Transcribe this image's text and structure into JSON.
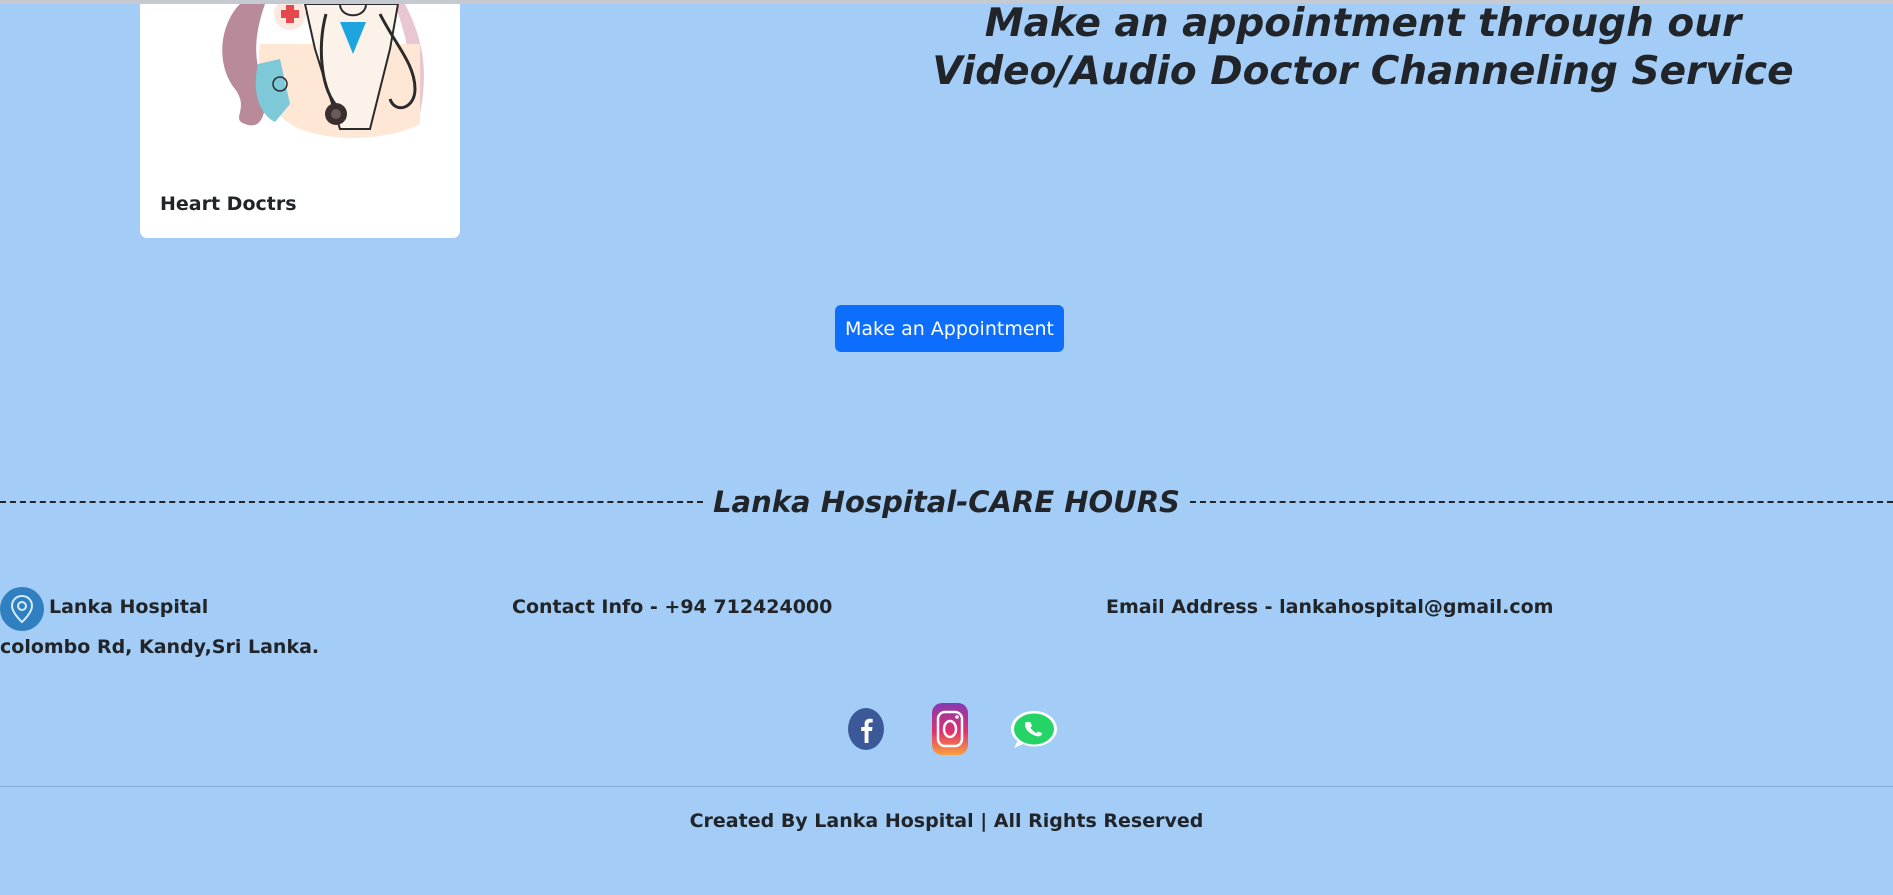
{
  "card": {
    "title": "Heart Doctrs",
    "image_icon": "doctor-illustration"
  },
  "headline": {
    "line1": "Make an appointment through our",
    "line2": "Video/Audio Doctor Channeling Service"
  },
  "appointment_button": "Make an Appointment",
  "care_hours": {
    "title": "Lanka Hospital-CARE HOURS"
  },
  "contact": {
    "hospital_name": "Lanka Hospital",
    "address": "colombo Rd, Kandy,Sri Lanka.",
    "phone": "Contact Info - +94 712424000",
    "email": "Email Address - lankahospital@gmail.com",
    "location_icon": "map-pin-icon"
  },
  "social": [
    {
      "name": "facebook",
      "icon": "facebook-icon",
      "color": "#3b5998"
    },
    {
      "name": "instagram",
      "icon": "instagram-icon",
      "color": "#c13584"
    },
    {
      "name": "whatsapp",
      "icon": "whatsapp-icon",
      "color": "#25d366"
    }
  ],
  "footer": {
    "text": "Created By Lanka Hospital | All Rights Reserved"
  },
  "colors": {
    "background": "#a3cdf6",
    "button": "#0d6efd",
    "text": "#212529"
  }
}
